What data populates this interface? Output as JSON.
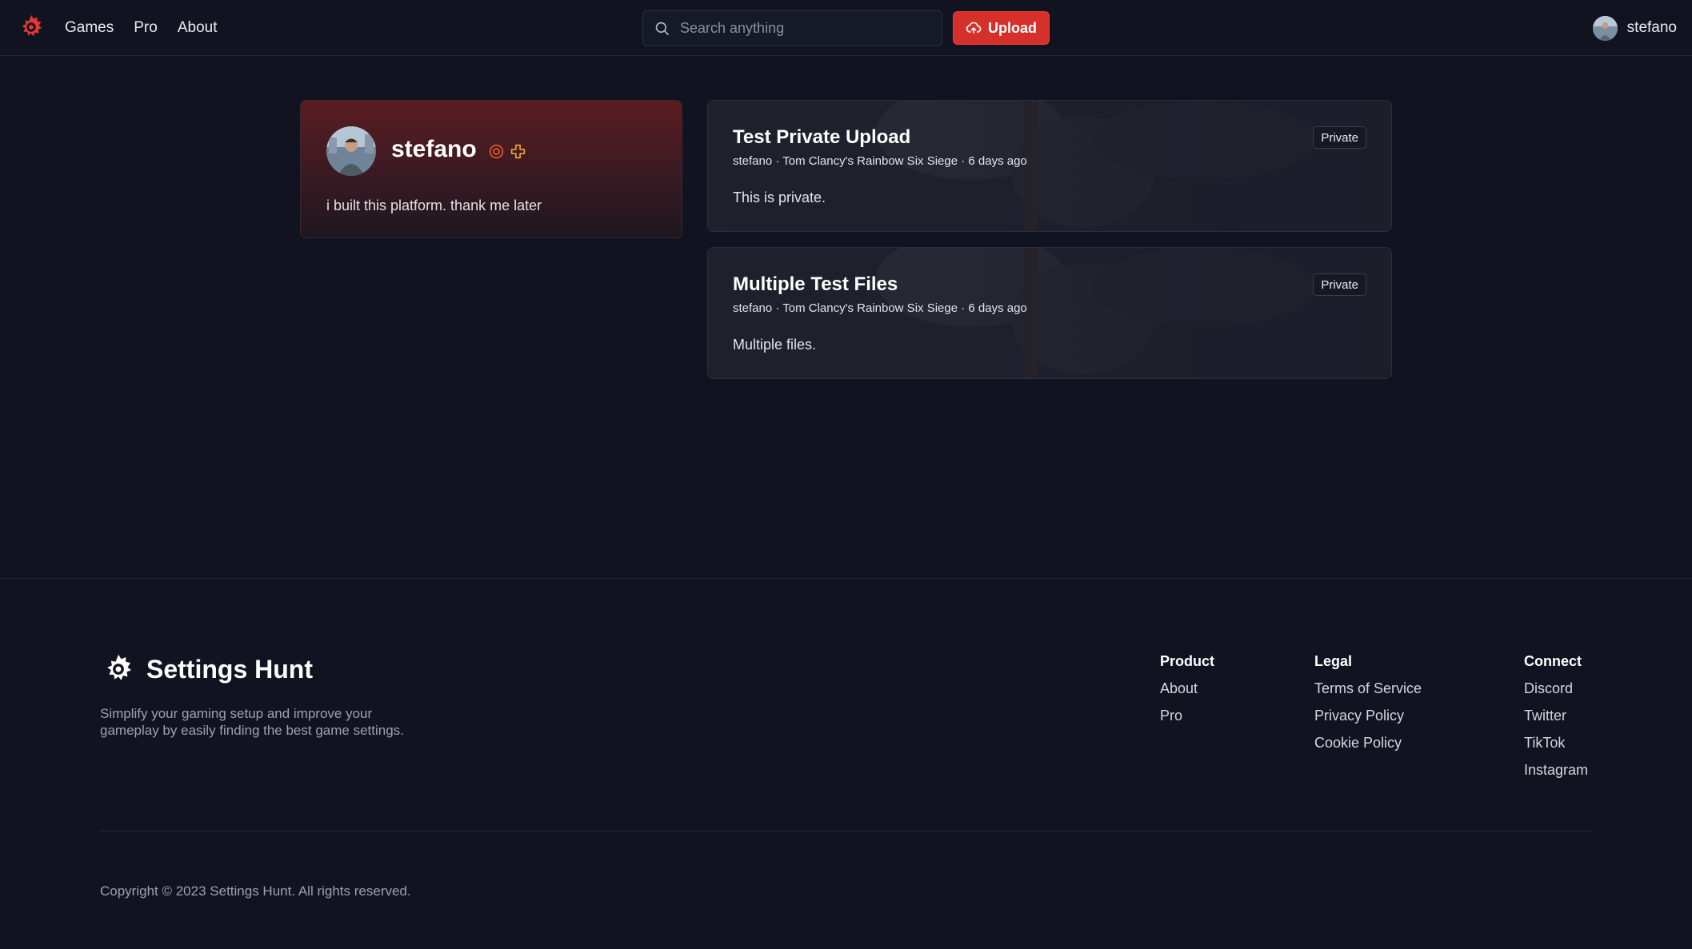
{
  "nav": {
    "links": [
      "Games",
      "Pro",
      "About"
    ],
    "search_placeholder": "Search anything",
    "upload_label": "Upload",
    "username": "stefano"
  },
  "profile": {
    "name": "stefano",
    "bio": "i built this platform. thank me later",
    "badges": [
      "target-badge-icon",
      "plus-badge-icon"
    ]
  },
  "uploads": [
    {
      "title": "Test Private Upload",
      "meta": "stefano · Tom Clancy's Rainbow Six Siege · 6 days ago",
      "description": "This is private.",
      "badge": "Private"
    },
    {
      "title": "Multiple Test Files",
      "meta": "stefano · Tom Clancy's Rainbow Six Siege · 6 days ago",
      "description": "Multiple files.",
      "badge": "Private"
    }
  ],
  "footer": {
    "brand": "Settings Hunt",
    "tagline": "Simplify your gaming setup and improve your gameplay by easily finding the best game settings.",
    "columns": {
      "product": {
        "heading": "Product",
        "links": [
          "About",
          "Pro"
        ]
      },
      "legal": {
        "heading": "Legal",
        "links": [
          "Terms of Service",
          "Privacy Policy",
          "Cookie Policy"
        ]
      },
      "connect": {
        "heading": "Connect",
        "links": [
          "Discord",
          "Twitter",
          "TikTok",
          "Instagram"
        ]
      }
    },
    "copyright": "Copyright © 2023 Settings Hunt. All rights reserved."
  },
  "colors": {
    "background": "#111420",
    "accent": "#d6302b",
    "badge_orange": "#e0572a",
    "badge_gold": "#e0a13a"
  }
}
